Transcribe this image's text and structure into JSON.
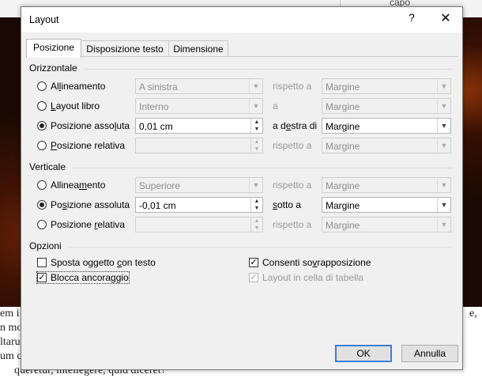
{
  "background": {
    "caption_fragment": "capo",
    "doc_lines": [
      {
        "left": "em i",
        "right": "e,"
      },
      {
        "left": "n mo",
        "right": ""
      },
      {
        "left": "ltaru",
        "right": ""
      },
      {
        "left": "um c",
        "right": ""
      },
      {
        "left": "queretur, intellegere, quid diceret?",
        "right": ""
      }
    ]
  },
  "dialog": {
    "title": "Layout",
    "help_symbol": "?",
    "close_symbol": "✕",
    "tabs": [
      {
        "label": "Posizione",
        "active": true
      },
      {
        "label": "Disposizione testo",
        "active": false
      },
      {
        "label": "Dimensione",
        "active": false
      }
    ],
    "horizontal": {
      "group_label": "Orizzontale",
      "rows": [
        {
          "label_pre": "Al",
          "label_u": "l",
          "label_post": "ineamento",
          "selected": false,
          "value": "A sinistra",
          "relation": "rispetto a",
          "target": "Margine",
          "enabled": false
        },
        {
          "label_pre": "",
          "label_u": "L",
          "label_post": "ayout libro",
          "selected": false,
          "value": "Interno",
          "relation": "a",
          "target": "Margine",
          "enabled": false
        },
        {
          "label_pre": "Posizione asso",
          "label_u": "l",
          "label_post": "uta",
          "selected": true,
          "value": "0,01 cm",
          "relation_pre": "a d",
          "relation_u": "e",
          "relation_post": "stra di",
          "target": "Margine",
          "enabled": true
        },
        {
          "label_pre": "",
          "label_u": "P",
          "label_post": "osizione relativa",
          "selected": false,
          "value": "",
          "relation": "rispetto a",
          "target": "Margine",
          "enabled": false
        }
      ]
    },
    "vertical": {
      "group_label": "Verticale",
      "rows": [
        {
          "label_pre": "Allinea",
          "label_u": "m",
          "label_post": "ento",
          "selected": false,
          "value": "Superiore",
          "relation": "rispetto a",
          "target": "Margine",
          "enabled": false
        },
        {
          "label_pre": "Po",
          "label_u": "s",
          "label_post": "izione assoluta",
          "selected": true,
          "value": "-0,01 cm",
          "relation_pre": "",
          "relation_u": "s",
          "relation_post": "otto a",
          "target": "Margine",
          "enabled": true
        },
        {
          "label_pre": "Posizione ",
          "label_u": "r",
          "label_post": "elativa",
          "selected": false,
          "value": "",
          "relation": "rispetto a",
          "target": "Margine",
          "enabled": false
        }
      ]
    },
    "options": {
      "group_label": "Opzioni",
      "move_with_text": {
        "pre": "Sposta oggetto ",
        "u": "c",
        "post": "on testo",
        "checked": false
      },
      "lock_anchor": {
        "label": "Blocca ancoraggio",
        "checked": true
      },
      "allow_overlap": {
        "pre": "Consenti so",
        "u": "v",
        "post": "rapposizione",
        "checked": true
      },
      "layout_in_cell": {
        "label": "Layout in cella di tabella",
        "checked": true,
        "enabled": false
      }
    },
    "buttons": {
      "ok": "OK",
      "cancel": "Annulla"
    },
    "glyphs": {
      "dropdown": "▼",
      "spin_up": "▲",
      "spin_down": "▼",
      "check": "✓"
    }
  }
}
